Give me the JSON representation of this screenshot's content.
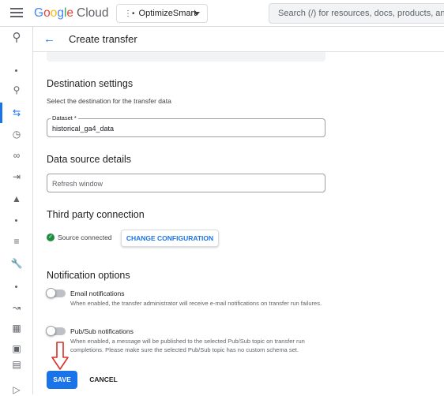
{
  "topbar": {
    "logo_google": [
      "G",
      "o",
      "o",
      "g",
      "l",
      "e"
    ],
    "logo_cloud": "Cloud",
    "project_name": "OptimizeSmart",
    "search_placeholder": "Search (/) for resources, docs, products, and m"
  },
  "header": {
    "title": "Create transfer"
  },
  "destination": {
    "heading": "Destination settings",
    "description": "Select the destination for the transfer data",
    "dataset_label": "Dataset *",
    "dataset_value": "historical_ga4_data"
  },
  "data_source": {
    "heading": "Data source details",
    "refresh_placeholder": "Refresh window"
  },
  "third_party": {
    "heading": "Third party connection",
    "status": "Source connected",
    "change_button": "CHANGE CONFIGURATION"
  },
  "notifications": {
    "heading": "Notification options",
    "email": {
      "label": "Email notifications",
      "description": "When enabled, the transfer administrator will receive e-mail notifications on transfer run failures.",
      "enabled": false
    },
    "pubsub": {
      "label": "Pub/Sub notifications",
      "description": "When enabled, a message will be published to the selected Pub/Sub topic on transfer run completions. Please make sure the selected Pub/Sub topic has no custom schema set.",
      "enabled": false
    }
  },
  "actions": {
    "save": "SAVE",
    "cancel": "CANCEL"
  },
  "rail_icons": [
    "bigquery-icon",
    "search-icon",
    "transfers-icon",
    "history-icon",
    "connections-icon",
    "pipeline-icon",
    "workflow-icon",
    "list-icon",
    "wrench-icon",
    "monitoring-icon",
    "dashboard-icon",
    "notes-icon",
    "expand-icon"
  ],
  "colors": {
    "accent": "#1a73e8",
    "connected": "#1e8e3e",
    "annotation_arrow": "#d93025"
  }
}
